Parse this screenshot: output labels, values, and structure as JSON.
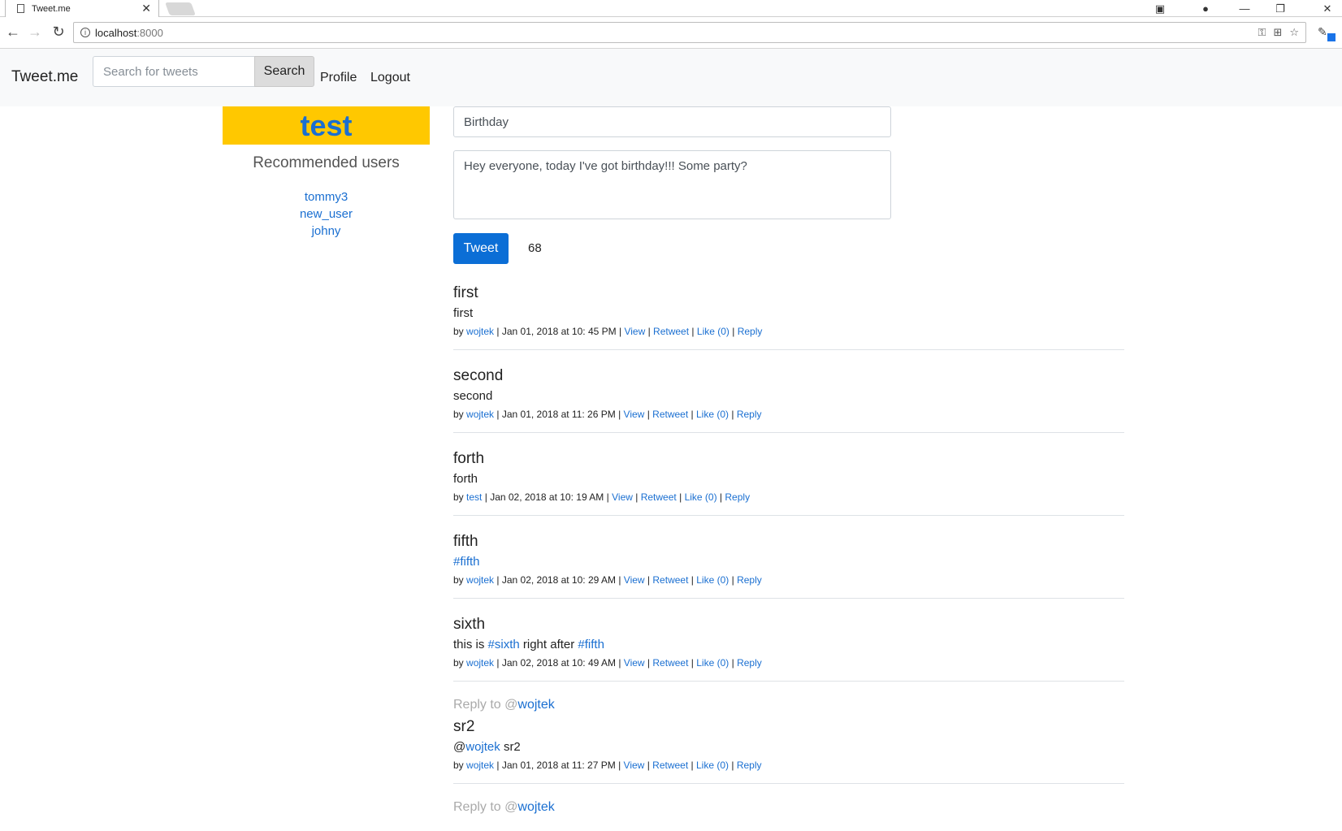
{
  "browser": {
    "tab_title": "Tweet.me",
    "close_glyph": "✕",
    "url_host": "localhost",
    "url_port": ":8000",
    "win_minimize": "—",
    "win_restore": "❐",
    "win_close": "✕"
  },
  "navbar": {
    "brand": "Tweet.me",
    "search_placeholder": "Search for tweets",
    "search_label": "Search",
    "profile_label": "Profile",
    "logout_label": "Logout"
  },
  "sidebar": {
    "username": "test",
    "recommended_title": "Recommended users",
    "users": [
      "tommy3",
      "new_user",
      "johny"
    ]
  },
  "composer": {
    "title_value": "Birthday",
    "body_value": "Hey everyone, today I've got birthday!!! Some party?",
    "tweet_label": "Tweet",
    "char_count": "68"
  },
  "meta_labels": {
    "by": "by",
    "view": "View",
    "retweet": "Retweet",
    "like": "Like (0)",
    "reply": "Reply",
    "reply_to": "Reply to",
    "at": "@"
  },
  "tweets": [
    {
      "title": "first",
      "body": "first",
      "author": "wojtek",
      "date": "Jan 01, 2018 at 10: 45 PM"
    },
    {
      "title": "second",
      "body": "second",
      "author": "wojtek",
      "date": "Jan 01, 2018 at 11: 26 PM"
    },
    {
      "title": "forth",
      "body": "forth",
      "author": "test",
      "date": "Jan 02, 2018 at 10: 19 AM"
    },
    {
      "title": "fifth",
      "body_tag": "#fifth",
      "author": "wojtek",
      "date": "Jan 02, 2018 at 10: 29 AM"
    },
    {
      "title": "sixth",
      "body_pre": "this is",
      "body_tag1": "#sixth",
      "body_mid": "right after",
      "body_tag2": "#fifth",
      "author": "wojtek",
      "date": "Jan 02, 2018 at 10: 49 AM"
    },
    {
      "reply_user": "wojtek",
      "title": "sr2",
      "body_mention": "wojtek",
      "body_rest": "sr2",
      "author": "wojtek",
      "date": "Jan 01, 2018 at 11: 27 PM"
    },
    {
      "reply_user": "wojtek"
    }
  ]
}
